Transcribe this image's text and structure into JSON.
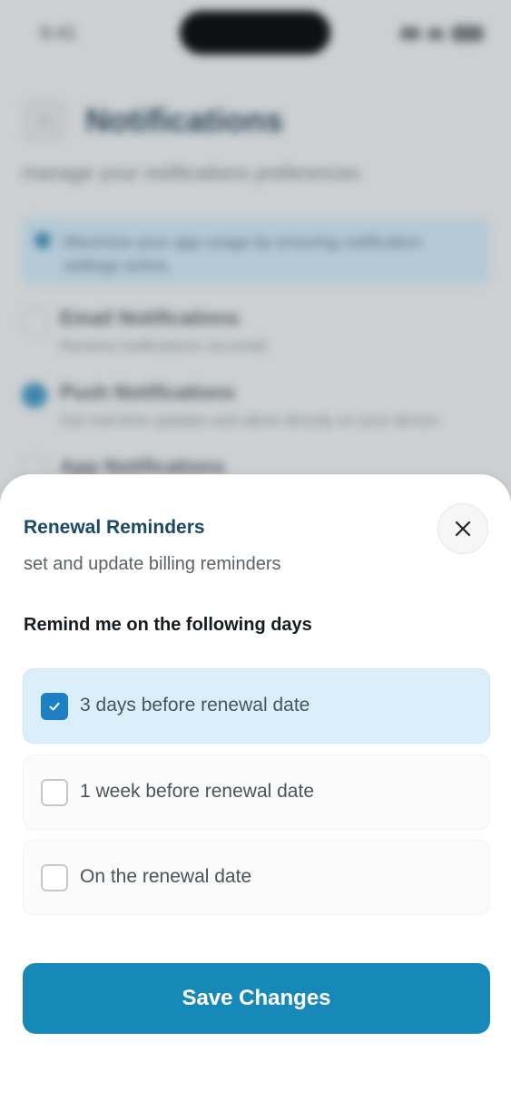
{
  "status_bar": {
    "time": "9:41"
  },
  "background": {
    "title": "Notifications",
    "subtitle": "manage your notifications preferences",
    "back_icon": "chevron-left-icon",
    "alert_text": "Maximize your app usage by ensuring notification settings active.",
    "rows": [
      {
        "title": "Email Notifications",
        "desc": "Receive notifications via email",
        "checked": false
      },
      {
        "title": "Push Notifications",
        "desc": "Get real-time updates and alerts directly on your device",
        "checked": true
      },
      {
        "title": "App Notifications",
        "desc": "",
        "checked": false
      }
    ]
  },
  "sheet": {
    "title": "Renewal Reminders",
    "subtitle": "set and update billing reminders",
    "close_icon": "close-icon",
    "section_heading": "Remind me on the following days",
    "options": [
      {
        "label": "3 days before renewal date",
        "checked": true
      },
      {
        "label": "1 week before renewal date",
        "checked": false
      },
      {
        "label": "On the renewal date",
        "checked": false
      }
    ],
    "save_label": "Save Changes"
  },
  "colors": {
    "accent": "#1789b8",
    "title": "#1b4a66",
    "checkbox_checked": "#1f7fc4",
    "selected_option_bg": "#dbeffb"
  }
}
